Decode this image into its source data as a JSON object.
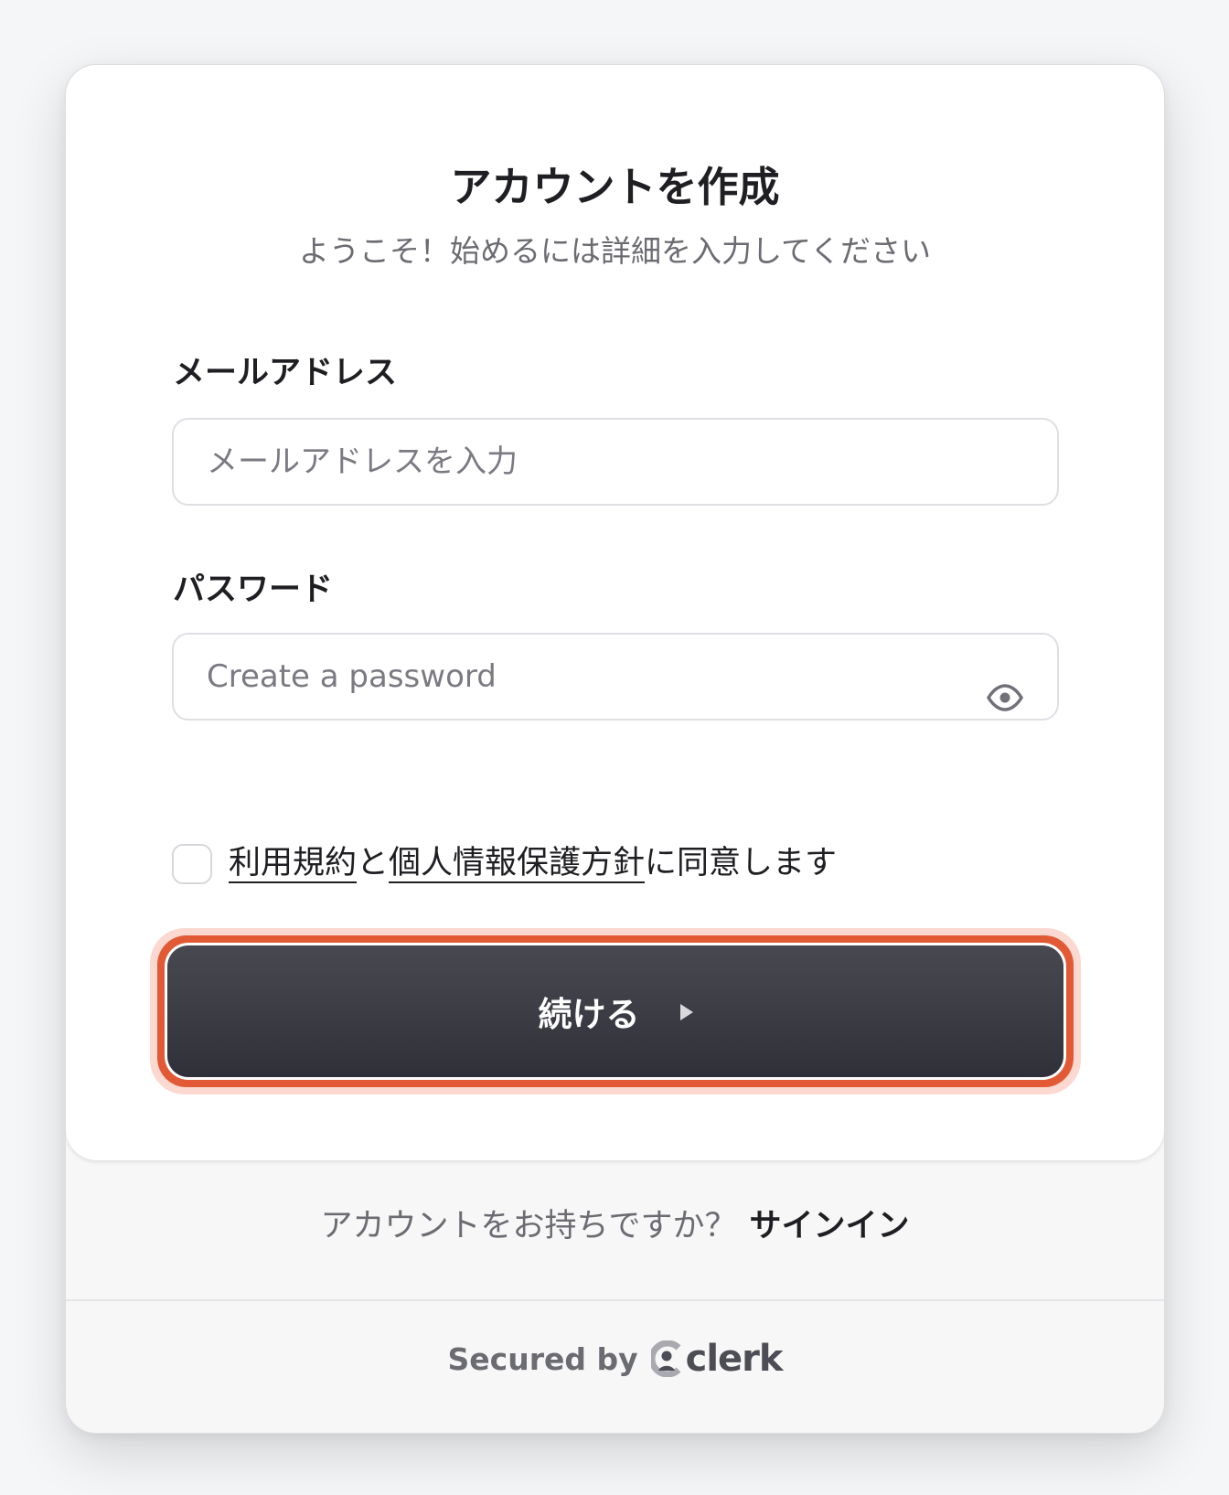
{
  "header": {
    "title": "アカウントを作成",
    "subtitle": "ようこそ！始めるには詳細を入力してください"
  },
  "email": {
    "label": "メールアドレス",
    "placeholder": "メールアドレスを入力",
    "value": ""
  },
  "password": {
    "label": "パスワード",
    "placeholder": "Create a password",
    "value": "",
    "toggle_icon": "eye-icon"
  },
  "consent": {
    "checked": false,
    "terms_link": "利用規約",
    "connector": "と",
    "privacy_link": "個人情報保護方針",
    "suffix": "に同意します"
  },
  "submit": {
    "label": "続ける",
    "icon": "play-icon",
    "accent_color": "#e25a35"
  },
  "footer": {
    "prompt": "アカウントをお持ちですか？",
    "signin_link": "サインイン",
    "secured_by": "Secured by",
    "brand": "clerk"
  }
}
